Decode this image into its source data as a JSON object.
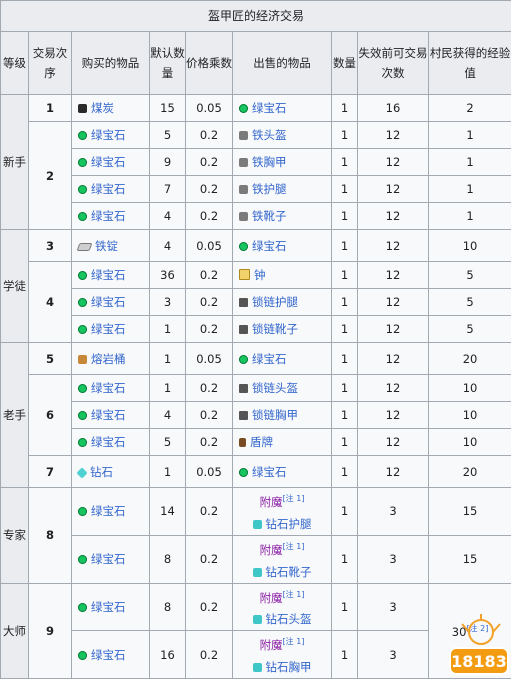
{
  "caption": "盔甲匠的经济交易",
  "headers": {
    "level": "等级",
    "trade_no": "交易次序",
    "buy_item": "购买的物品",
    "default_qty": "默认数量",
    "price_mult": "价格乘数",
    "sell_item": "出售的物品",
    "qty": "数量",
    "max_uses": "失效前可交易次数",
    "villager_xp": "村民获得的经验值"
  },
  "levels": {
    "novice": "新手",
    "apprentice": "学徒",
    "journeyman": "老手",
    "expert": "专家",
    "master": "大师"
  },
  "trades": {
    "t1": "1",
    "t2": "2",
    "t3": "3",
    "t4": "4",
    "t5": "5",
    "t6": "6",
    "t7": "7",
    "t8": "8",
    "t9": "9"
  },
  "rows": [
    {
      "buy": "煤炭",
      "buy_icon": "coal-icon",
      "dq": "15",
      "pm": "0.05",
      "sell": "绿宝石",
      "sell_icon": "emerald-icon",
      "qty": "1",
      "uses": "16",
      "xp": "2"
    },
    {
      "buy": "绿宝石",
      "buy_icon": "emerald-icon",
      "dq": "5",
      "pm": "0.2",
      "sell": "铁头盔",
      "sell_icon": "iron-helmet-icon",
      "qty": "1",
      "uses": "12",
      "xp": "1"
    },
    {
      "buy": "绿宝石",
      "buy_icon": "emerald-icon",
      "dq": "9",
      "pm": "0.2",
      "sell": "铁胸甲",
      "sell_icon": "iron-chestplate-icon",
      "qty": "1",
      "uses": "12",
      "xp": "1"
    },
    {
      "buy": "绿宝石",
      "buy_icon": "emerald-icon",
      "dq": "7",
      "pm": "0.2",
      "sell": "铁护腿",
      "sell_icon": "iron-leggings-icon",
      "qty": "1",
      "uses": "12",
      "xp": "1"
    },
    {
      "buy": "绿宝石",
      "buy_icon": "emerald-icon",
      "dq": "4",
      "pm": "0.2",
      "sell": "铁靴子",
      "sell_icon": "iron-boots-icon",
      "qty": "1",
      "uses": "12",
      "xp": "1"
    },
    {
      "buy": "铁锭",
      "buy_icon": "iron-ingot-icon",
      "dq": "4",
      "pm": "0.05",
      "sell": "绿宝石",
      "sell_icon": "emerald-icon",
      "qty": "1",
      "uses": "12",
      "xp": "10"
    },
    {
      "buy": "绿宝石",
      "buy_icon": "emerald-icon",
      "dq": "36",
      "pm": "0.2",
      "sell": "钟",
      "sell_icon": "bell-icon",
      "qty": "1",
      "uses": "12",
      "xp": "5"
    },
    {
      "buy": "绿宝石",
      "buy_icon": "emerald-icon",
      "dq": "3",
      "pm": "0.2",
      "sell": "锁链护腿",
      "sell_icon": "chainmail-leggings-icon",
      "qty": "1",
      "uses": "12",
      "xp": "5"
    },
    {
      "buy": "绿宝石",
      "buy_icon": "emerald-icon",
      "dq": "1",
      "pm": "0.2",
      "sell": "锁链靴子",
      "sell_icon": "chainmail-boots-icon",
      "qty": "1",
      "uses": "12",
      "xp": "5"
    },
    {
      "buy": "熔岩桶",
      "buy_icon": "lava-bucket-icon",
      "dq": "1",
      "pm": "0.05",
      "sell": "绿宝石",
      "sell_icon": "emerald-icon",
      "qty": "1",
      "uses": "12",
      "xp": "20"
    },
    {
      "buy": "绿宝石",
      "buy_icon": "emerald-icon",
      "dq": "1",
      "pm": "0.2",
      "sell": "锁链头盔",
      "sell_icon": "chainmail-helmet-icon",
      "qty": "1",
      "uses": "12",
      "xp": "10"
    },
    {
      "buy": "绿宝石",
      "buy_icon": "emerald-icon",
      "dq": "4",
      "pm": "0.2",
      "sell": "锁链胸甲",
      "sell_icon": "chainmail-chestplate-icon",
      "qty": "1",
      "uses": "12",
      "xp": "10"
    },
    {
      "buy": "绿宝石",
      "buy_icon": "emerald-icon",
      "dq": "5",
      "pm": "0.2",
      "sell": "盾牌",
      "sell_icon": "shield-icon",
      "qty": "1",
      "uses": "12",
      "xp": "10"
    },
    {
      "buy": "钻石",
      "buy_icon": "diamond-icon",
      "dq": "1",
      "pm": "0.05",
      "sell": "绿宝石",
      "sell_icon": "emerald-icon",
      "qty": "1",
      "uses": "12",
      "xp": "20"
    },
    {
      "buy": "绿宝石",
      "buy_icon": "emerald-icon",
      "dq": "14",
      "pm": "0.2",
      "ench": "附魔",
      "note": "[注 1]",
      "sell": "钻石护腿",
      "sell_icon": "diamond-leggings-icon",
      "qty": "1",
      "uses": "3",
      "xp": "15"
    },
    {
      "buy": "绿宝石",
      "buy_icon": "emerald-icon",
      "dq": "8",
      "pm": "0.2",
      "ench": "附魔",
      "note": "[注 1]",
      "sell": "钻石靴子",
      "sell_icon": "diamond-boots-icon",
      "qty": "1",
      "uses": "3",
      "xp": "15"
    },
    {
      "buy": "绿宝石",
      "buy_icon": "emerald-icon",
      "dq": "8",
      "pm": "0.2",
      "ench": "附魔",
      "note": "[注 1]",
      "sell": "钻石头盔",
      "sell_icon": "diamond-helmet-icon",
      "qty": "1",
      "uses": "3",
      "xp": "30",
      "xp_note": "[注 2]"
    },
    {
      "buy": "绿宝石",
      "buy_icon": "emerald-icon",
      "dq": "16",
      "pm": "0.2",
      "ench": "附魔",
      "note": "[注 1]",
      "sell": "钻石胸甲",
      "sell_icon": "diamond-chestplate-icon",
      "qty": "1",
      "uses": "3",
      "xp": ""
    }
  ],
  "watermark": "18183"
}
